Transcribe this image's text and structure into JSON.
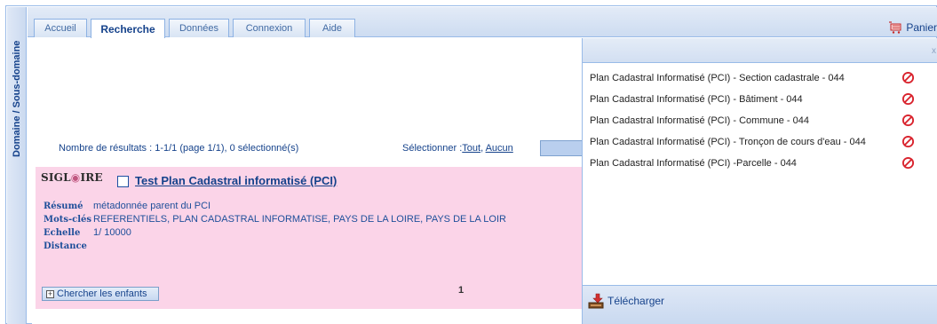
{
  "sidebar": {
    "label": "Domaine / Sous-domaine"
  },
  "tabs": [
    {
      "label": "Accueil",
      "active": false
    },
    {
      "label": "Recherche",
      "active": true
    },
    {
      "label": "Données",
      "active": false
    },
    {
      "label": "Connexion",
      "active": false
    },
    {
      "label": "Aide",
      "active": false
    }
  ],
  "header": {
    "basket_label": "Panier"
  },
  "results": {
    "count_text": "Nombre de résultats :  1-1/1  (page 1/1),  0 sélectionné(s)",
    "select_label": "Sélectionner :",
    "select_all": "Tout",
    "select_none": "Aucun",
    "separator": ","
  },
  "record": {
    "logo_text_1": "SIGL",
    "logo_text_2": "IRE",
    "title": "Test Plan Cadastral informatisé (PCI)",
    "fields": [
      {
        "label": "Résumé",
        "value": "métadonnée parent du PCI"
      },
      {
        "label": "Mots-clés",
        "value": "REFERENTIELS, PLAN CADASTRAL INFORMATISE, PAYS DE LA LOIRE, PAYS DE LA LOIR"
      },
      {
        "label": "Echelle",
        "value": "1/ 10000"
      },
      {
        "label": "Distance",
        "value": ""
      }
    ],
    "children_button": "Chercher les enfants"
  },
  "pager": {
    "page": "1"
  },
  "basket": {
    "close_glyph": "x",
    "items": [
      "Plan Cadastral Informatisé (PCI) - Section cadastrale - 044",
      "Plan Cadastral Informatisé (PCI) - Bâtiment - 044",
      "Plan Cadastral Informatisé (PCI) - Commune - 044",
      "Plan Cadastral Informatisé (PCI) - Tronçon de cours d'eau - 044",
      "Plan Cadastral Informatisé (PCI) -Parcelle - 044"
    ],
    "download_label": "Télécharger"
  },
  "colors": {
    "accent": "#15428b",
    "record_bg": "#fbd4e8",
    "forbid": "#d9232d"
  },
  "icons": {
    "basket": "cart-icon",
    "remove": "forbidden-icon",
    "download": "download-icon",
    "expand": "plus-box-icon"
  }
}
